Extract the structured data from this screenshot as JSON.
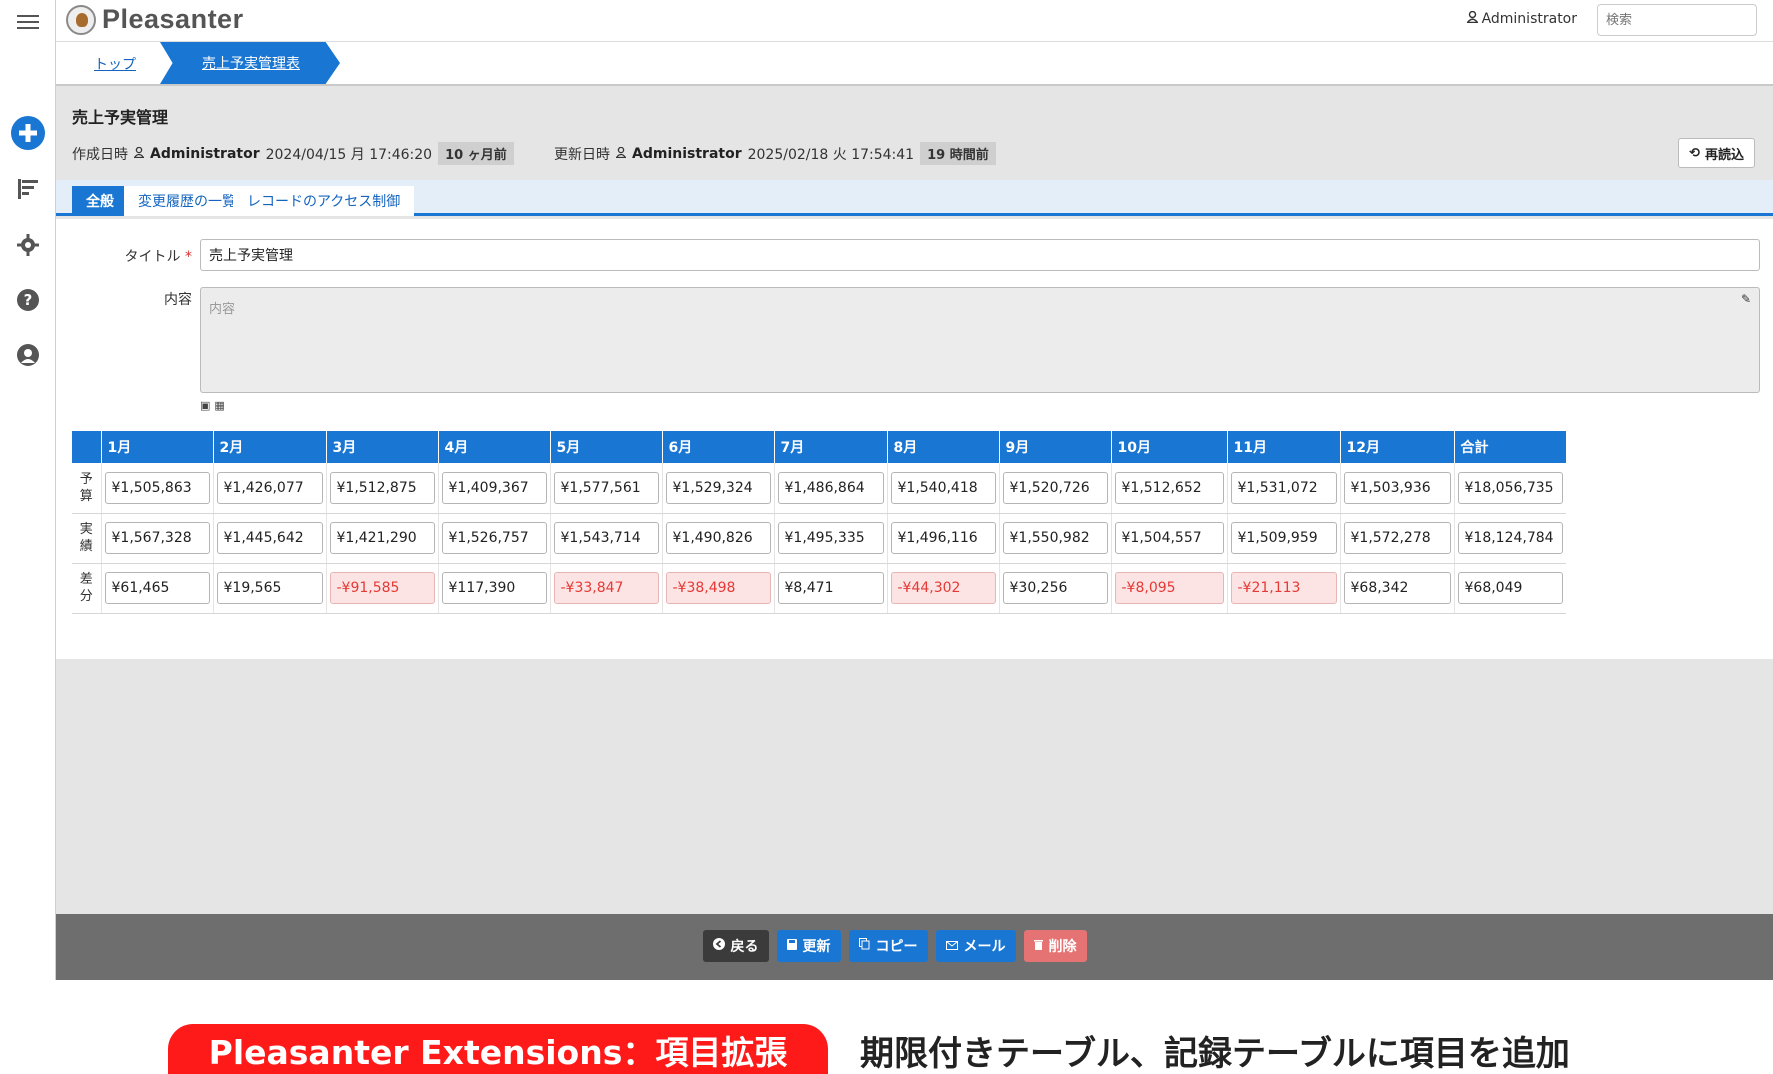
{
  "app": {
    "name": "Pleasanter",
    "user": "Administrator",
    "search_placeholder": "検索"
  },
  "breadcrumb": {
    "top": "トップ",
    "current": "売上予実管理表"
  },
  "record": {
    "title": "売上予実管理",
    "created_label": "作成日時",
    "created_user": "Administrator",
    "created_at": "2024/04/15 月 17:46:20",
    "created_ago": "10 ヶ月前",
    "updated_label": "更新日時",
    "updated_user": "Administrator",
    "updated_at": "2025/02/18 火 17:54:41",
    "updated_ago": "19 時間前",
    "reload_label": "再読込"
  },
  "tabs": [
    "全般",
    "変更履歴の一覧",
    "レコードのアクセス制御"
  ],
  "form": {
    "title_label": "タイトル",
    "title_value": "売上予実管理",
    "content_label": "内容",
    "content_placeholder": "内容"
  },
  "table": {
    "columns": [
      "1月",
      "2月",
      "3月",
      "4月",
      "5月",
      "6月",
      "7月",
      "8月",
      "9月",
      "10月",
      "11月",
      "12月",
      "合計"
    ],
    "rows": [
      {
        "label": "予算",
        "values": [
          "¥1,505,863",
          "¥1,426,077",
          "¥1,512,875",
          "¥1,409,367",
          "¥1,577,561",
          "¥1,529,324",
          "¥1,486,864",
          "¥1,540,418",
          "¥1,520,726",
          "¥1,512,652",
          "¥1,531,072",
          "¥1,503,936",
          "¥18,056,735"
        ]
      },
      {
        "label": "実績",
        "values": [
          "¥1,567,328",
          "¥1,445,642",
          "¥1,421,290",
          "¥1,526,757",
          "¥1,543,714",
          "¥1,490,826",
          "¥1,495,335",
          "¥1,496,116",
          "¥1,550,982",
          "¥1,504,557",
          "¥1,509,959",
          "¥1,572,278",
          "¥18,124,784"
        ]
      },
      {
        "label": "差分",
        "values": [
          "¥61,465",
          "¥19,565",
          "-¥91,585",
          "¥117,390",
          "-¥33,847",
          "-¥38,498",
          "¥8,471",
          "-¥44,302",
          "¥30,256",
          "-¥8,095",
          "-¥21,113",
          "¥68,342",
          "¥68,049"
        ]
      }
    ]
  },
  "footer": {
    "back": "戻る",
    "update": "更新",
    "copy": "コピー",
    "mail": "メール",
    "delete": "削除"
  },
  "caption": {
    "pill": "Pleasanter Extensions：項目拡張",
    "text": "期限付きテーブル、記録テーブルに項目を追加"
  },
  "colors": {
    "primary": "#1976d2",
    "negative": "#e53935",
    "caption_red": "#ff1a1a"
  }
}
